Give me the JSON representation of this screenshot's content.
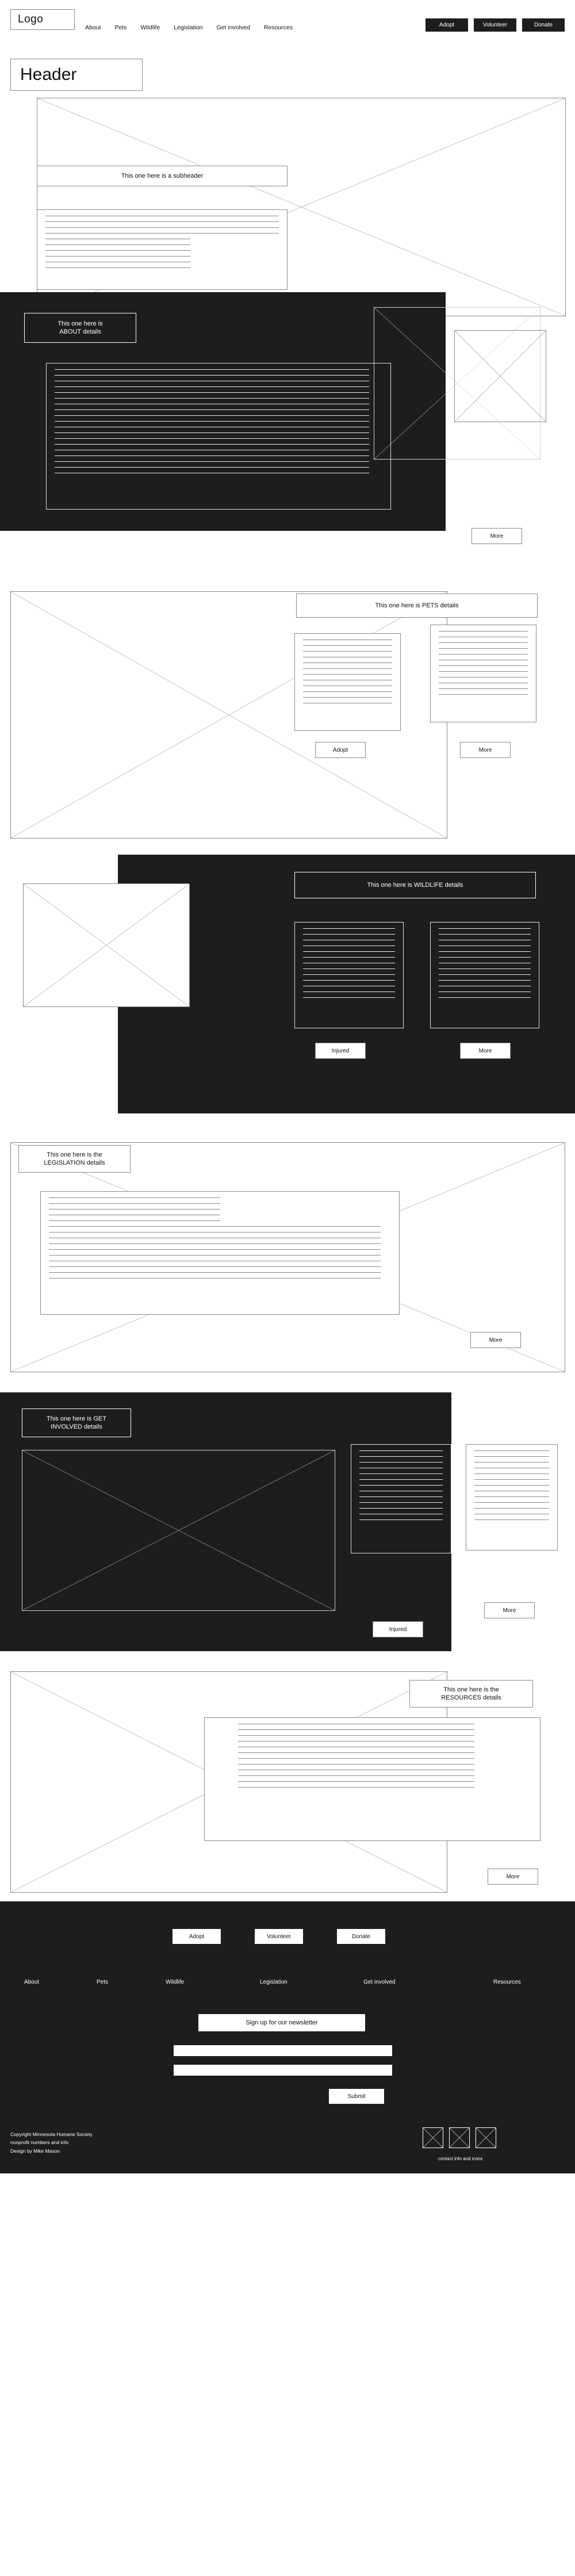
{
  "nav": {
    "logo": "Logo",
    "links": [
      "About",
      "Pets",
      "Wildlife",
      "Legislation",
      "Get involved",
      "Resources"
    ],
    "ctas": [
      "Adopt",
      "Volunteer",
      "Donate"
    ]
  },
  "hero": {
    "title": "Header",
    "subheader": "This one here is a subheader"
  },
  "sections": [
    {
      "id": "about",
      "label": "This one here is\nABOUT details",
      "buttons": [
        "More"
      ]
    },
    {
      "id": "pets",
      "label": "This one here is PETS details",
      "buttons": [
        "Adopt",
        "More"
      ]
    },
    {
      "id": "wildlife",
      "label": "This one here is WILDLIFE details",
      "buttons": [
        "Injured",
        "More"
      ]
    },
    {
      "id": "legislation",
      "label": "This one here is the\nLEGISLATION details",
      "buttons": [
        "More"
      ]
    },
    {
      "id": "get-involved",
      "label": "This one here is GET\nINVOLVED details",
      "buttons": [
        "Injured",
        "More"
      ]
    },
    {
      "id": "resources",
      "label": "This one here is the\nRESOURCES details",
      "buttons": [
        "More"
      ]
    }
  ],
  "footer": {
    "ctas": [
      "Adopt",
      "Volunteer",
      "Donate"
    ],
    "links": [
      "About",
      "Pets",
      "Wildlife",
      "Legislation",
      "Get involved",
      "Resources"
    ],
    "newsletter_label": "Sign up for our newsletter",
    "input_one": "",
    "input_two": "",
    "submit_label": "Submit",
    "copyright_lines": [
      "Copyright  Minnesota Humane Society",
      "nonprofit numbers and info",
      "Design by Mike Mason"
    ],
    "icons_caption": "contact info and icons"
  }
}
